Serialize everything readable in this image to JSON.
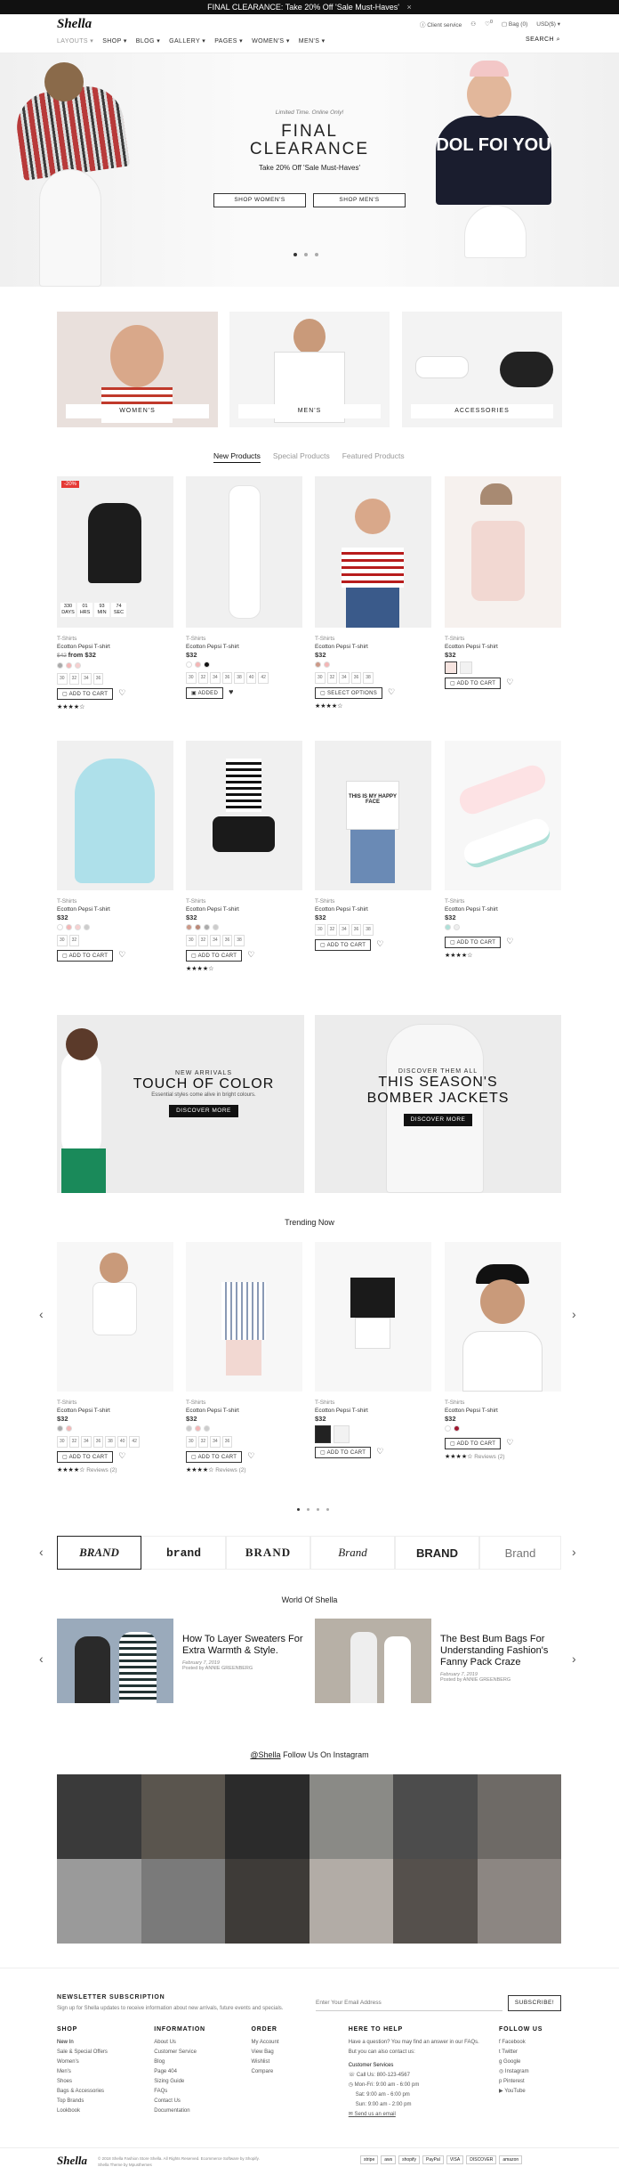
{
  "topbar": {
    "text": "FINAL CLEARANCE: Take 20% Off 'Sale Must-Haves'",
    "close": "×"
  },
  "header": {
    "logo": "Shella",
    "nav": [
      "LAYOUTS ▾",
      "SHOP ▾",
      "BLOG ▾",
      "GALLERY ▾",
      "PAGES ▾",
      "WOMEN'S ▾",
      "MEN'S ▾"
    ],
    "util": {
      "service": "Client service",
      "wishlist_count": "0",
      "bag": "Bag (0)",
      "currency": "USD($) ▾",
      "search": "SEARCH"
    }
  },
  "hero": {
    "eyebrow": "Limited Time. Online Only!",
    "title1": "FINAL",
    "title2": "CLEARANCE",
    "sub": "Take 20% Off 'Sale Must-Haves'",
    "btn1": "SHOP WOMEN'S",
    "btn2": "SHOP MEN'S",
    "shirt_text": "DOL FOI YOU"
  },
  "categories": [
    "WOMEN'S",
    "MEN'S",
    "ACCESSORIES"
  ],
  "tabs": [
    "New Products",
    "Special Products",
    "Featured Products"
  ],
  "products_row1": [
    {
      "cat": "T-Shirts",
      "name": "Ecotton Pepsi T-shirt",
      "old": "$42",
      "price": "from $32",
      "badge": "-20%",
      "swatches": [
        "#aaa",
        "#f4b6b6",
        "#f6d0d0"
      ],
      "sizes": [
        "30",
        "32",
        "34",
        "36"
      ],
      "btn": "ADD TO CART",
      "stars": "★★★★☆",
      "timer": [
        "330",
        "01",
        "93",
        "74"
      ],
      "timer_lbl": [
        "DAYS",
        "HRS",
        "MIN",
        "SEC"
      ]
    },
    {
      "cat": "T-Shirts",
      "name": "Ecotton Pepsi T-shirt",
      "price": "$32",
      "swatches": [
        "#fff",
        "#f4b6b6",
        "#111"
      ],
      "sizes": [
        "30",
        "32",
        "34",
        "36",
        "38",
        "40",
        "42"
      ],
      "btn": "ADDED"
    },
    {
      "cat": "T-Shirts",
      "name": "Ecotton Pepsi T-shirt",
      "price": "$32",
      "swatches": [
        "#c98",
        "#f4b6b6"
      ],
      "sizes": [
        "30",
        "32",
        "34",
        "36",
        "38"
      ],
      "btn": "SELECT OPTIONS",
      "stars": "★★★★☆"
    },
    {
      "cat": "T-Shirts",
      "name": "Ecotton Pepsi T-shirt",
      "price": "$32",
      "btn": "ADD TO CART"
    }
  ],
  "products_row2": [
    {
      "cat": "T-Shirts",
      "name": "Ecotton Pepsi T-shirt",
      "price": "$32",
      "swatches": [
        "#fff",
        "#f4b6b6",
        "#f6d0d0",
        "#ccc"
      ],
      "sizes": [
        "30",
        "32"
      ],
      "btn": "ADD TO CART"
    },
    {
      "cat": "T-Shirts",
      "name": "Ecotton Pepsi T-shirt",
      "price": "$32",
      "swatches": [
        "#c98",
        "#b87",
        "#aaa",
        "#ccc"
      ],
      "sizes": [
        "30",
        "32",
        "34",
        "36",
        "38"
      ],
      "btn": "ADD TO CART",
      "stars": "★★★★☆"
    },
    {
      "cat": "T-Shirts",
      "name": "Ecotton Pepsi T-shirt",
      "price": "$32",
      "sizes": [
        "30",
        "32",
        "34",
        "36",
        "38"
      ],
      "btn": "ADD TO CART"
    },
    {
      "cat": "T-Shirts",
      "name": "Ecotton Pepsi T-shirt",
      "price": "$32",
      "swatches": [
        "#aee0d8",
        "#eee"
      ],
      "btn": "ADD TO CART",
      "stars": "★★★★☆"
    }
  ],
  "hero_shirt2": "THIS IS MY HAPPY FACE",
  "promo1": {
    "t1": "NEW ARRIVALS",
    "t2": "TOUCH OF COLOR",
    "t3": "Essential styles come alive in bright colours.",
    "btn": "DISCOVER MORE"
  },
  "promo2": {
    "t1": "DISCOVER THEM ALL",
    "t2a": "THIS SEASON'S",
    "t2b": "BOMBER JACKETS",
    "btn": "DISCOVER MORE"
  },
  "trending_title": "Trending Now",
  "trending": [
    {
      "cat": "T-Shirts",
      "name": "Ecotton Pepsi T-shirt",
      "price": "$32",
      "swatches": [
        "#aaa",
        "#f4b6b6"
      ],
      "sizes": [
        "30",
        "32",
        "34",
        "36",
        "38",
        "40",
        "42"
      ],
      "btn": "ADD TO CART",
      "stars": "★★★★☆",
      "reviews": "Reviews (2)"
    },
    {
      "cat": "T-Shirts",
      "name": "Ecotton Pepsi T-shirt",
      "price": "$32",
      "swatches": [
        "#ccc",
        "#f4b6b6",
        "#ccc"
      ],
      "sizes": [
        "30",
        "32",
        "34",
        "36"
      ],
      "btn": "ADD TO CART",
      "stars": "★★★★☆",
      "reviews": "Reviews (2)"
    },
    {
      "cat": "T-Shirts",
      "name": "Ecotton Pepsi T-shirt",
      "price": "$32",
      "btn": "ADD TO CART"
    },
    {
      "cat": "T-Shirts",
      "name": "Ecotton Pepsi T-shirt",
      "price": "$32",
      "swatches": [
        "#fff",
        "#a01830"
      ],
      "btn": "ADD TO CART",
      "stars": "★★★★☆",
      "reviews": "Reviews (2)"
    }
  ],
  "brands": [
    "BRAND",
    "brand",
    "BRAND",
    "Brand",
    "BRAND",
    "Brand"
  ],
  "blog_title": "World Of Shella",
  "blog": [
    {
      "title": "How To Layer Sweaters For Extra Warmth & Style.",
      "date": "February 7, 2019",
      "by": "Posted by ANNIE GREENBERG"
    },
    {
      "title": "The Best Bum Bags For Understanding Fashion's Fanny Pack Craze",
      "date": "February 7, 2019",
      "by": "Posted by ANNIE GREENBERG"
    }
  ],
  "insta_title_handle": "@Shella",
  "insta_title_rest": " Follow Us On Instagram",
  "newsletter": {
    "title": "NEWSLETTER SUBSCRIPTION",
    "desc": "Sign up for Shella updates to receive information about new arrivals, future events and specials.",
    "placeholder": "Enter Your Email Address",
    "btn": "SUBSCRIBE!"
  },
  "footer": [
    {
      "h": "SHOP",
      "items": [
        "New In",
        "Sale & Special Offers",
        "Women's",
        "Men's",
        "Shoes",
        "Bags & Accessories",
        "Top Brands",
        "Lookbook"
      ]
    },
    {
      "h": "INFORMATION",
      "items": [
        "About Us",
        "Customer Service",
        "Blog",
        "Page 404",
        "Sizing Guide",
        "FAQs",
        "Contact Us",
        "Documentation"
      ]
    },
    {
      "h": "ORDER",
      "items": [
        "My Account",
        "View Bag",
        "Wishlist",
        "Compare"
      ]
    },
    {
      "h": "HERE TO HELP",
      "items": [
        "Have a question? You may find an answer in our FAQs.",
        "But you can also contact us:",
        "Customer Services",
        "Call Us: 800-123-4567",
        "Mon-Fri: 9:00 am - 6:00 pm",
        "Sat: 9:00 am - 6:00 pm",
        "Sun: 9:00 am - 2:00 pm",
        "Send us an email"
      ]
    },
    {
      "h": "FOLLOW US",
      "items": [
        "Facebook",
        "Twitter",
        "Google",
        "Instagram",
        "Pinterest",
        "YouTube"
      ]
    }
  ],
  "bottom": {
    "logo": "Shella",
    "copy": "© 2018 Shella Fashion Store Shella. All Rights Reserved. Ecommerce Software by Shopify.",
    "copy2": "Shella Theme by Mpusthemes",
    "payments": [
      "stripe",
      "aws",
      "shopify",
      "PayPal",
      "VISA",
      "DISCOVER",
      "amazon"
    ]
  }
}
